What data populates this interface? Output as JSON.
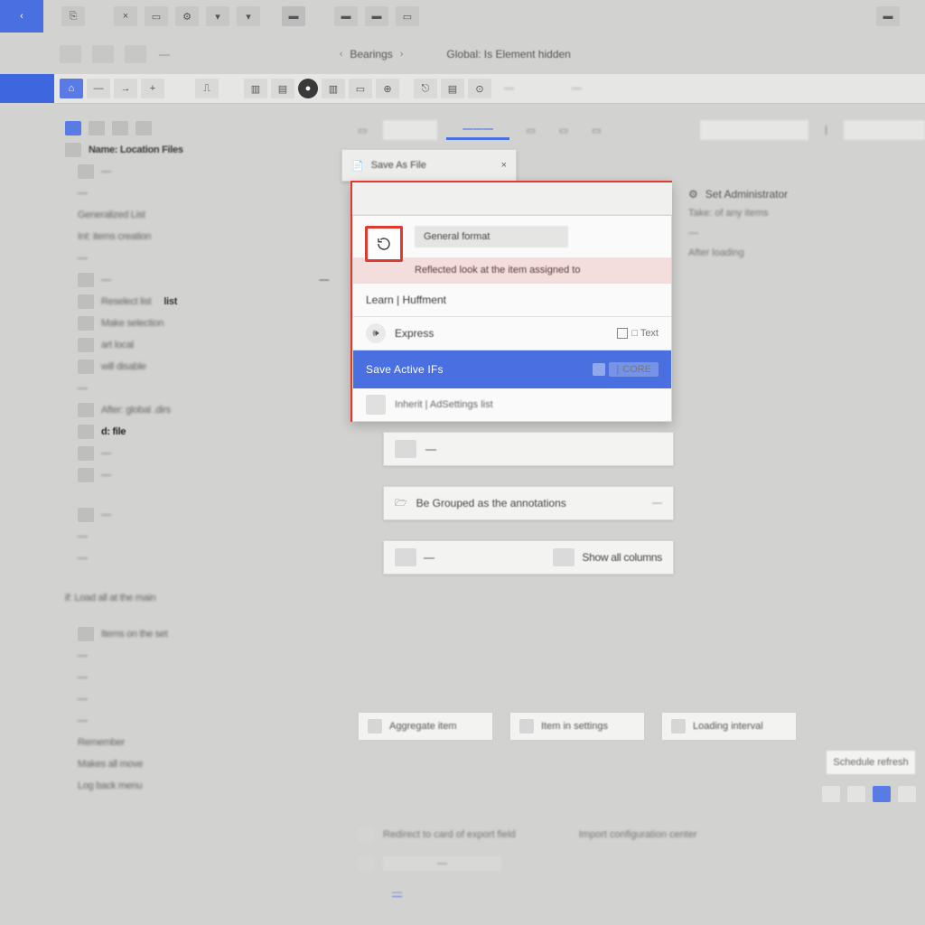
{
  "colors": {
    "accent": "#4a6fe0",
    "danger": "#e03a2f",
    "bg": "#d2d2d1"
  },
  "top": {
    "back_glyph": "‹"
  },
  "toolbar_icons": [
    "A1",
    "A2",
    "A3",
    "A4",
    "A5",
    "A6",
    "A7",
    "A8",
    "A9",
    "A10",
    "A11",
    "A12"
  ],
  "breadcrumb": {
    "label1": "Bearings",
    "label2": "Global: Is Element hidden"
  },
  "ribbon_icons": [
    "r1",
    "r2",
    "r3",
    "r4",
    "r5",
    "r6",
    "r7",
    "r8",
    "r9",
    "r10",
    "r11",
    "r12",
    "r13",
    "r14"
  ],
  "ribbon_text1": "—",
  "ribbon_text2": "—",
  "sidebar": {
    "head1": "Name: Location Files",
    "items": [
      "—",
      "—",
      "Generalized List",
      "Int: items creation",
      "—",
      "—",
      "Reselect   list",
      "Make selection",
      "art local",
      "will disable",
      "—",
      "After: global .dirs",
      "d:   file",
      "—",
      "—",
      "—",
      "—",
      "—"
    ],
    "foot1": "if: Load all at the main",
    "foot_items": [
      "Items on the set",
      "—",
      "—",
      "—",
      "—",
      "Remember",
      "Makes all move",
      "Log back menu"
    ]
  },
  "tabs": {
    "t1": "—",
    "active": "———",
    "icons": 3
  },
  "floatcard": {
    "label": "Save As File",
    "close": "×"
  },
  "popup": {
    "marked_label": "General format",
    "marked_sub": "Reflected look at the item assigned to",
    "row_learn": "Learn | Huffment",
    "row_express": "Express",
    "row_express_right": "□ Text",
    "selected_label": "Save Active IFs",
    "selected_badge": "CORE",
    "row_inherit": "Inherit | AdSettings list"
  },
  "cards": {
    "c1": "—",
    "c2_label": "Be Grouped as the annotations",
    "c2_right": "—",
    "c3_left": "—",
    "c3_right": "Show all columns"
  },
  "rpanel": {
    "hdr": "Set Administrator",
    "lines": [
      "Take: of any items",
      "—",
      "After loading"
    ]
  },
  "btnrow": {
    "b1": "Aggregate item",
    "b2": "Item in settings",
    "b3": "Loading interval"
  },
  "bottom_chip": "Schedule refresh",
  "footerlines": {
    "l1": "Redirect to card of export field",
    "l1r": "Import configuration center",
    "l2": "—",
    "l3_link": "—"
  }
}
